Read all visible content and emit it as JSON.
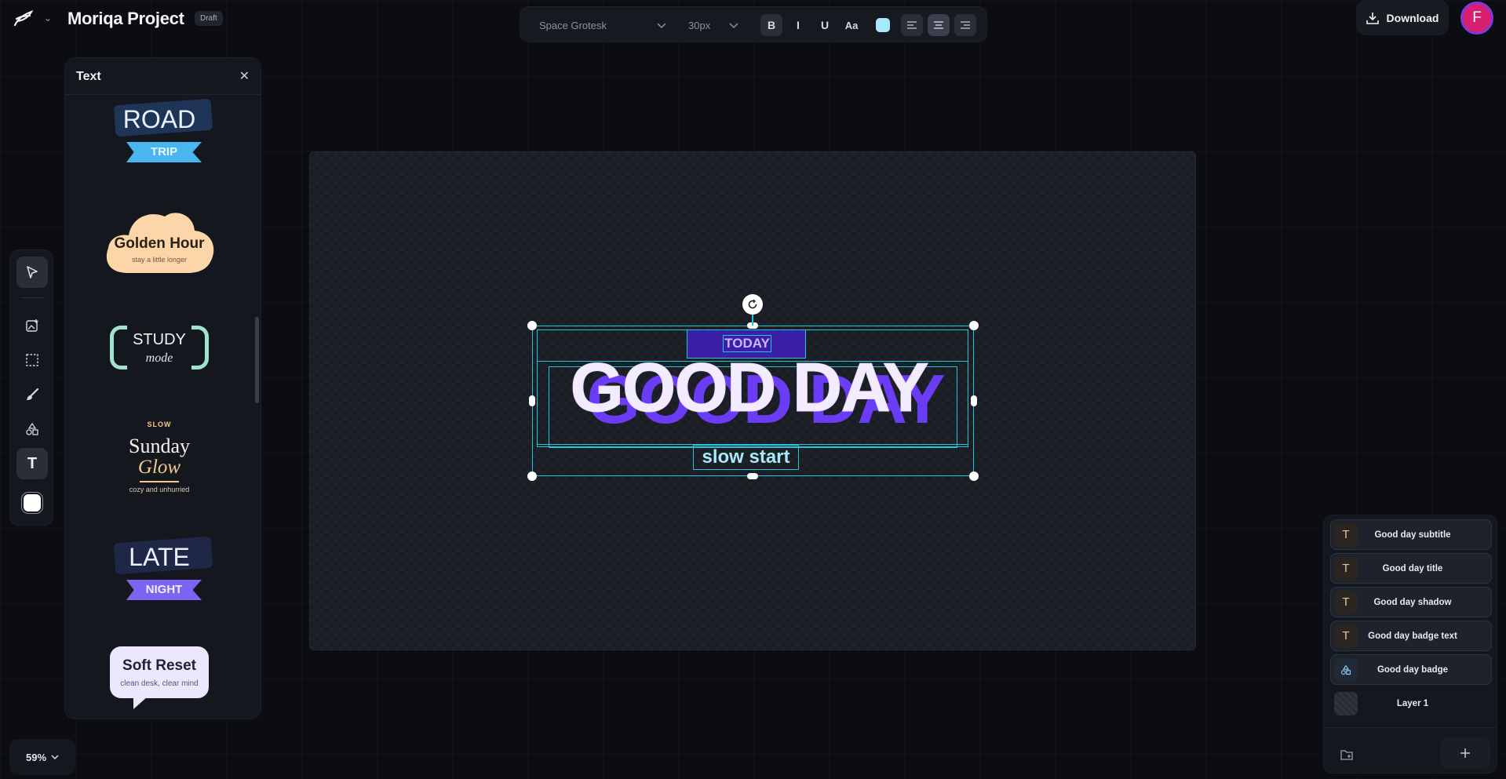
{
  "app": {
    "project_title": "Moriqa Project",
    "status_badge": "Draft"
  },
  "toolbar": {
    "font_family": "Space Grotesk",
    "font_size": "30px",
    "bold": "B",
    "italic": "I",
    "underline": "U",
    "case": "Aa",
    "text_color": "#a7e9fb",
    "align_selected": "center"
  },
  "header_actions": {
    "download_label": "Download",
    "avatar_initial": "F"
  },
  "text_panel": {
    "title": "Text",
    "templates": [
      {
        "name": "road-trip",
        "line1": "ROAD",
        "line2": "TRIP"
      },
      {
        "name": "golden-hour",
        "line1": "Golden Hour",
        "line2": "stay a little longer"
      },
      {
        "name": "study-mode",
        "line1": "STUDY",
        "line2": "mode"
      },
      {
        "name": "sunday-glow",
        "line0": "SLOW",
        "line1": "Sunday",
        "line2": "Glow",
        "line3": "cozy and unhurried"
      },
      {
        "name": "late-night",
        "line1": "LATE",
        "line2": "NIGHT"
      },
      {
        "name": "soft-reset",
        "line1": "Soft Reset",
        "line2": "clean desk, clear mind"
      }
    ]
  },
  "tools": [
    {
      "icon": "select-pointer-icon",
      "active": true
    },
    {
      "icon": "add-image-icon"
    },
    {
      "icon": "selection-rect-icon"
    },
    {
      "icon": "brush-icon"
    },
    {
      "icon": "shapes-icon"
    },
    {
      "icon": "text-tool-icon",
      "label": "T"
    },
    {
      "icon": "color-swatch-icon",
      "color": "#ffffff"
    }
  ],
  "zoom": {
    "value": "59%"
  },
  "canvas_design": {
    "badge_text": "TODAY",
    "title": "GOOD DAY",
    "subtitle": "slow start",
    "colors": {
      "badge_bg": "#3b1fa6",
      "badge_text": "#c5b8ff",
      "title": "#f3ecff",
      "shadow": "#6b3cf5",
      "subtitle": "#a7e9fb",
      "selection": "#1fc6dc"
    }
  },
  "layers": {
    "items": [
      {
        "name": "Good day subtitle",
        "icon": "T",
        "type": "text"
      },
      {
        "name": "Good day title",
        "icon": "T",
        "type": "text"
      },
      {
        "name": "Good day shadow",
        "icon": "T",
        "type": "text"
      },
      {
        "name": "Good day badge text",
        "icon": "T",
        "type": "text"
      },
      {
        "name": "Good day badge",
        "type": "shape"
      },
      {
        "name": "Layer 1",
        "type": "background"
      }
    ]
  }
}
